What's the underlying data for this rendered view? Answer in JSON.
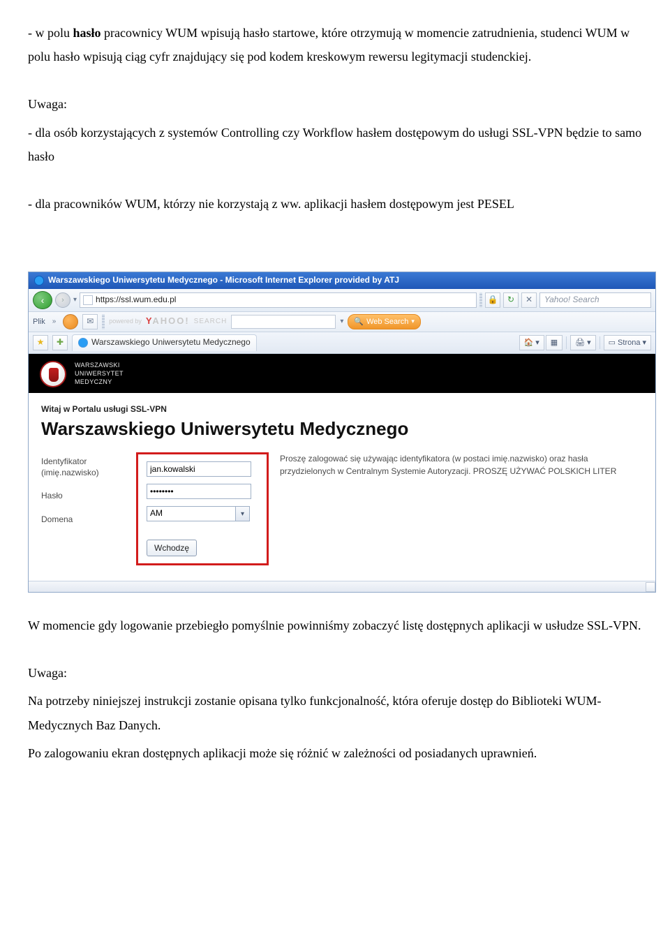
{
  "doc": {
    "p1_prefix": "- w polu ",
    "p1_bold": "hasło",
    "p1_rest": " pracownicy WUM wpisują hasło startowe, które otrzymują w momencie zatrudnienia, studenci WUM w polu hasło wpisują ciąg cyfr znajdujący się pod kodem kreskowym rewersu legitymacji studenckiej.",
    "note_label": "Uwaga:",
    "p2": "- dla osób korzystających z systemów Controlling czy Workflow hasłem dostępowym do usługi SSL-VPN będzie to samo hasło",
    "p3": "- dla pracowników WUM, którzy nie korzystają z ww. aplikacji hasłem dostępowym jest PESEL",
    "after1": "W momencie gdy logowanie przebiegło pomyślnie powinniśmy zobaczyć listę dostępnych aplikacji w usłudze SSL-VPN.",
    "note_label2": "Uwaga:",
    "after2": "Na potrzeby niniejszej instrukcji zostanie opisana tylko funkcjonalność, która oferuje dostęp do Biblioteki WUM- Medycznych Baz Danych.",
    "after3": "Po zalogowaniu ekran dostępnych aplikacji może się różnić w zależności od posiadanych uprawnień."
  },
  "ie": {
    "title": "Warszawskiego Uniwersytetu Medycznego - Microsoft Internet Explorer provided by ATJ",
    "url": "https://ssl.wum.edu.pl",
    "search_placeholder": "Yahoo! Search",
    "plk": "Plik",
    "yahoo_brand_red": "Y",
    "yahoo_brand_rest": "AHOO!",
    "yahoo_search_word": "SEARCH",
    "web_search": "Web Search",
    "tab_title": "Warszawskiego Uniwersytetu Medycznego",
    "tool_strona": "Strona",
    "nav_back": "‹",
    "nav_fwd": "›",
    "powered": "powered by",
    "chev": "»"
  },
  "page": {
    "wum_line1": "WARSZAWSKI",
    "wum_line2": "UNIWERSYTET",
    "wum_line3": "MEDYCZNY",
    "welcome_small": "Witaj w Portalu usługi SSL-VPN",
    "welcome_big": "Warszawskiego Uniwersytetu Medycznego",
    "label_id_1": "Identyfikator",
    "label_id_2": "(imię.nazwisko)",
    "label_pass": "Hasło",
    "label_domain": "Domena",
    "val_id": "jan.kowalski",
    "val_pass": "••••••••",
    "val_domain": "AM",
    "btn_enter": "Wchodzę",
    "help": "Proszę zalogować się używając identyfikatora (w postaci imię.nazwisko) oraz hasła przydzielonych w Centralnym Systemie Autoryzacji. PROSZĘ UŻYWAĆ POLSKICH LITER"
  }
}
